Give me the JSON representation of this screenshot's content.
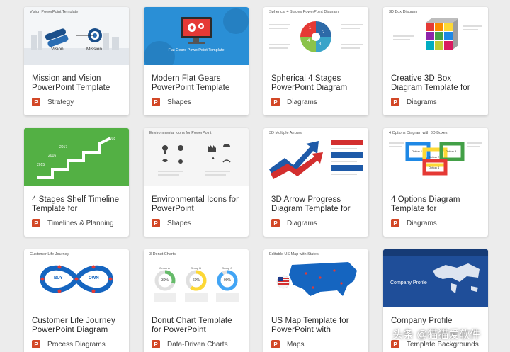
{
  "cards": [
    {
      "title": "Mission and Vision PowerPoint Template",
      "category": "Strategy",
      "thumb_label": "Vision PowerPoint Template",
      "thumb_words": [
        "Vision",
        "Mission"
      ]
    },
    {
      "title": "Modern Flat Gears PowerPoint Template",
      "category": "Shapes",
      "thumb_label": "Flat Gears PowerPoint Template"
    },
    {
      "title": "Spherical 4 Stages PowerPoint Diagram",
      "category": "Diagrams",
      "thumb_label": "Spherical 4 Stages PowerPoint Diagram",
      "thumb_numbers": [
        "1",
        "2",
        "3",
        "4"
      ]
    },
    {
      "title": "Creative 3D Box Diagram Template for",
      "category": "Diagrams",
      "thumb_label": "3D Box Diagram"
    },
    {
      "title": "4 Stages Shelf Timeline Template for",
      "category": "Timelines & Planning",
      "thumb_years": [
        "2015",
        "2016",
        "2017",
        "2018"
      ]
    },
    {
      "title": "Environmental Icons for PowerPoint",
      "category": "Shapes",
      "thumb_label": "Environmental Icons for PowerPoint"
    },
    {
      "title": "3D Arrow Progress Diagram Template for",
      "category": "Diagrams",
      "thumb_label": "3D Multiple Arrows"
    },
    {
      "title": "4 Options Diagram Template for",
      "category": "Diagrams",
      "thumb_label": "4 Options Diagram with 3D Boxes",
      "thumb_options": [
        "Option 1",
        "Option 2",
        "Option 3",
        "Option 4"
      ]
    },
    {
      "title": "Customer Life Journey PowerPoint Diagram",
      "category": "Process Diagrams",
      "thumb_label": "Customer Life Journey",
      "thumb_words": [
        "BUY",
        "OWN"
      ]
    },
    {
      "title": "Donut Chart Template for PowerPoint",
      "category": "Data-Driven Charts",
      "thumb_label": "3 Donut Charts",
      "thumb_groups": [
        "Group A",
        "Group B",
        "Group C"
      ],
      "thumb_values": [
        "30%",
        "60%",
        "90%"
      ]
    },
    {
      "title": "US Map Template for PowerPoint with",
      "category": "Maps",
      "thumb_label": "Editable US Map with States"
    },
    {
      "title": "Company Profile",
      "category": "Template Backgrounds",
      "thumb_label": "Company Profile"
    }
  ],
  "watermark": {
    "text": "头条 @猫猫爱软件"
  },
  "colors": {
    "ppt": "#d24726",
    "card_bg": "#ffffff",
    "page_bg": "#ececec"
  }
}
